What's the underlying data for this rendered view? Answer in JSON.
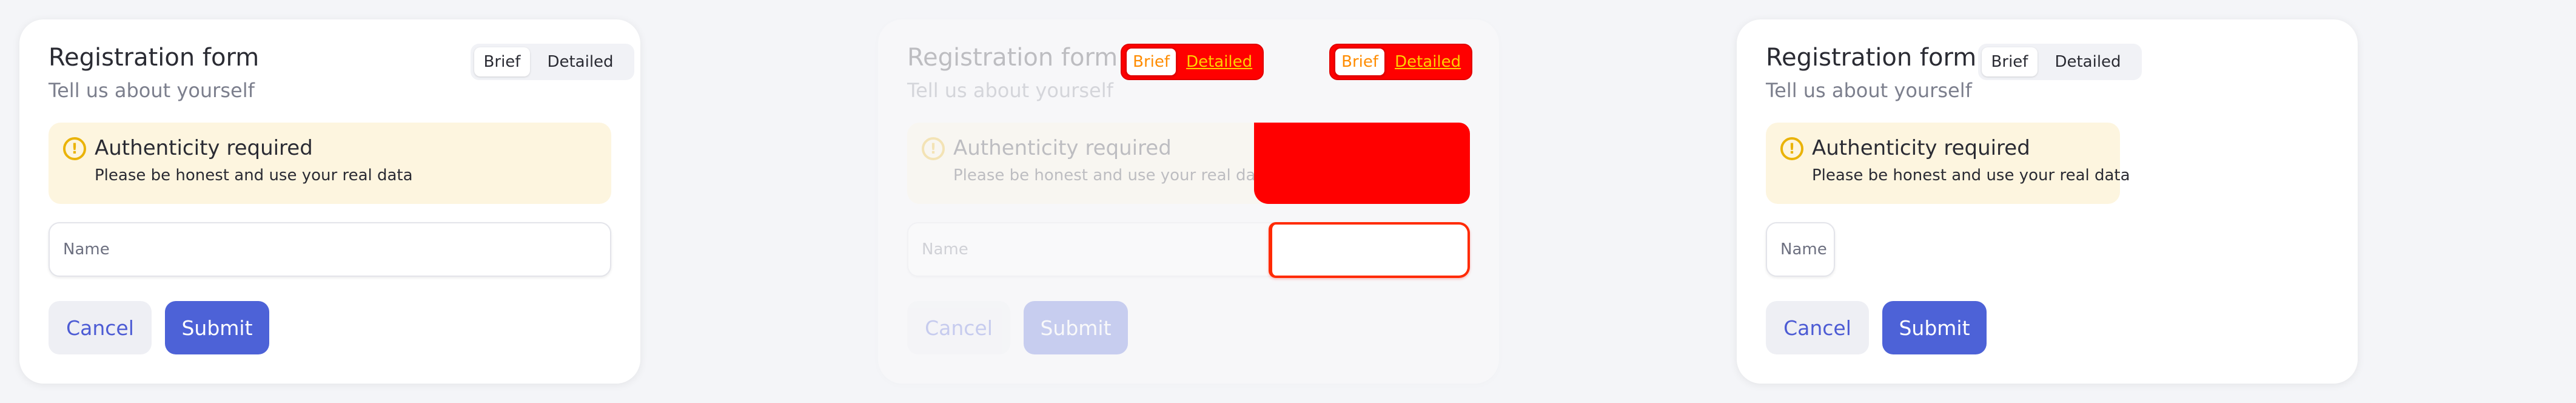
{
  "form": {
    "title": "Registration form",
    "subtitle": "Tell us about yourself",
    "toggle": {
      "brief": "Brief",
      "detailed": "Detailed"
    },
    "alert": {
      "icon": "exclamation-circle-icon",
      "title": "Authenticity required",
      "description": "Please be honest and use your real data"
    },
    "name_placeholder": "Name",
    "cancel_label": "Cancel",
    "submit_label": "Submit"
  },
  "colors": {
    "primary": "#4d62d7",
    "alert_bg": "#fdf5df",
    "alert_icon": "#eab308",
    "debug_red": "#ff0000"
  }
}
